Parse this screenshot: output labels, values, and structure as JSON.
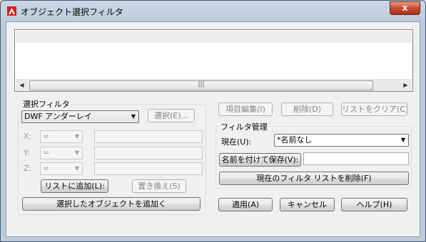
{
  "window": {
    "title": "オブジェクト選択フィルタ",
    "close_glyph": "x"
  },
  "scrollbar": {
    "left_arrow": "◀",
    "right_arrow": "▶",
    "thumb_grip": "|||"
  },
  "select_filter": {
    "group_label": "選択フィルタ",
    "filter_combo_value": "DWF アンダーレイ",
    "select_button": "選択(E)...",
    "x_label": "X:",
    "y_label": "Y:",
    "z_label": "Z:",
    "x_operator": "=",
    "y_operator": "=",
    "z_operator": "=",
    "add_to_list_button": "リストに追加(L):",
    "replace_button": "置き換え(S)",
    "add_selected_button": "選択したオブジェクトを追加く"
  },
  "list_actions": {
    "edit_item_button": "項目編集(I)",
    "delete_button": "削除(D)",
    "clear_list_button": "リストをクリア(C)"
  },
  "filter_management": {
    "group_label": "フィルタ管理",
    "current_label": "現在(U):",
    "current_value": "*名前なし",
    "save_as_button": "名前を付けて保存(V):",
    "save_as_value": "",
    "delete_current_button": "現在のフィルタ リストを削除(F)"
  },
  "footer": {
    "apply_button": "適用(A)",
    "cancel_button": "キャンセル",
    "help_button": "ヘルプ(H)"
  },
  "colors": {
    "title_bar": "#c9d7e6",
    "close_button": "#c74a2f",
    "app_icon": "#d0231b"
  }
}
